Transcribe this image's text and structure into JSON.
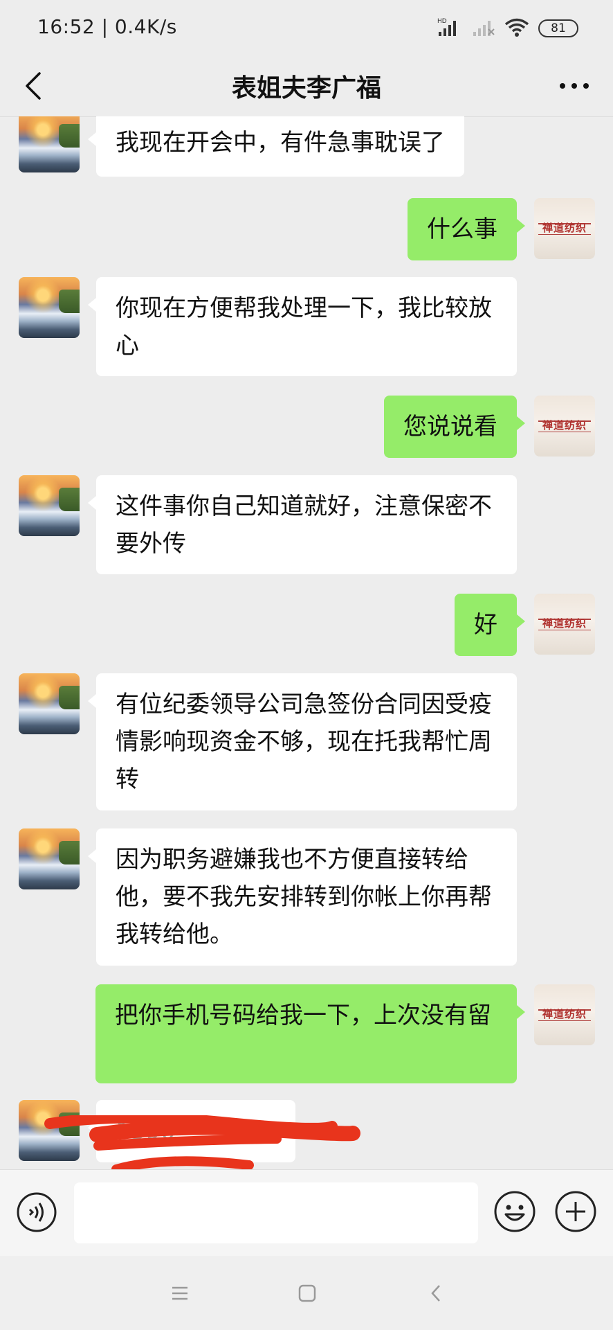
{
  "status_bar": {
    "time": "16:52 | 0.4K/s",
    "battery": "81",
    "hd_label": "HD"
  },
  "header": {
    "title": "表姐夫李广福"
  },
  "contact": {
    "avatar": "waterfall-sunset-avatar"
  },
  "self": {
    "avatar_text": "禅道纺织"
  },
  "messages": [
    {
      "side": "left",
      "text": "我现在开会中，有件急事耽误了"
    },
    {
      "side": "right",
      "text": "什么事"
    },
    {
      "side": "left",
      "text": "你现在方便帮我处理一下，我比较放心"
    },
    {
      "side": "right",
      "text": "您说说看"
    },
    {
      "side": "left",
      "text": "这件事你自己知道就好，注意保密不要外传"
    },
    {
      "side": "right",
      "text": "好"
    },
    {
      "side": "left",
      "text": "有位纪委领导公司急签份合同因受疫情影响现资金不够，现在托我帮忙周转"
    },
    {
      "side": "left",
      "text": "因为职务避嫌我也不方便直接转给他，要不我先安排转到你帐上你再帮我转给他。"
    },
    {
      "side": "right",
      "text": "把你手机号码给我一下，上次没有留"
    },
    {
      "side": "left",
      "text": "1390"
    }
  ],
  "input_bar": {
    "value": "",
    "icons": [
      "voice-icon",
      "emoji-icon",
      "plus-icon"
    ]
  },
  "nav_bar": {
    "icons": [
      "menu-icon",
      "home-icon",
      "back-icon"
    ]
  },
  "colors": {
    "background": "#ededed",
    "bubble_self": "#95ec69",
    "bubble_other": "#ffffff",
    "redaction": "#e8341c"
  }
}
